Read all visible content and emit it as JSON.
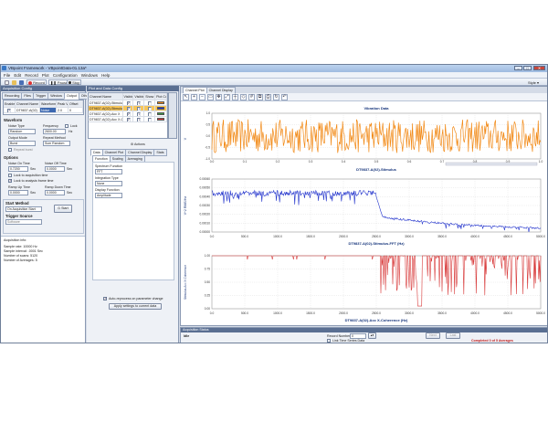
{
  "window": {
    "title": "VBpoint Framework - VBpointData-01.13a*",
    "min": "–",
    "max": "□",
    "close": "✕"
  },
  "menu": [
    "File",
    "Edit",
    "Record",
    "Plot",
    "Configuration",
    "Windows",
    "Help"
  ],
  "toolbar": {
    "record": "Record",
    "pause": "Pause",
    "stop": "Stop",
    "right": "Style ▾"
  },
  "acq": {
    "header": "Acquisition Config",
    "tabs": [
      "Recording",
      "Files",
      "Trigger",
      "Window",
      "Output",
      "Others"
    ],
    "channel_headers": [
      "Enabled",
      "Channel Name",
      "Waveform",
      "Peak Voltage",
      "Offset"
    ],
    "channel_row": {
      "name": "DT9837-A(02)",
      "waveform": "Noise",
      "peak": "2.0",
      "offset": "0"
    },
    "waveform_heading": "Waveform",
    "noise_type_label": "Noise Type",
    "noise_type": "Random",
    "frequency_label": "Frequency",
    "frequency": "2600.00",
    "freq_unit": "Hz",
    "lock_label": "Lock",
    "output_mode_label": "Output Mode",
    "output_mode": "Burst",
    "repeat_label": "Repeat Method",
    "repeat": "Sum Random",
    "repeat_burst": "Repeat burst",
    "options_heading": "Options",
    "noise_on_label": "Noise On Time",
    "noise_on": "0.7200",
    "noise_on_unit": "Sec",
    "noise_off_label": "Noise Off Time",
    "noise_off": "0.0000",
    "noise_off_unit": "Sec",
    "lock_acq": "Lock to acquisition time",
    "lock_frame": "Lock to analysis frame time",
    "ramp_up_label": "Ramp Up Time",
    "ramp_up": "0.0000",
    "ramp_up_unit": "Sec",
    "ramp_down_label": "Ramp Down Time",
    "ramp_down": "0.0000",
    "ramp_down_unit": "Sec",
    "start_heading": "Start Method",
    "start_method": "On Acquisition Start",
    "start_btn": "Start",
    "trigger_label": "Trigger Source",
    "trigger": "Software",
    "info_heading": "Acquisition info:",
    "info": [
      "Sample rate: 10000 Hz",
      "Sample interval: .0001 Sec",
      "Number of scans: 5120",
      "Number of Averages: 5"
    ]
  },
  "plot": {
    "header": "Plot and Data Config",
    "columns": [
      "Channel Name",
      "Visible Plot",
      "Visible Display",
      "Show Cursor",
      "Plot Colour"
    ],
    "rows": [
      {
        "name": "DT9837-A(02)-Stimulus",
        "sel": false,
        "color": "#f28a17"
      },
      {
        "name": "DT9837-A(02)-Stimulus-FFT",
        "sel": true,
        "color": "#2233cc"
      },
      {
        "name": "DT9837-A(02)-Acc X",
        "sel": false,
        "color": "#3c9a4a"
      },
      {
        "name": "DT9837-A(02)-Acc X-Cohere",
        "sel": false,
        "color": "#d83a3a"
      }
    ],
    "actions": "Actions",
    "tabs1": [
      "Data",
      "Channel Plot",
      "Channel Display",
      "Stats"
    ],
    "tabs2": [
      "Function",
      "Scaling",
      "Averaging"
    ],
    "spectrum_label": "Spectrum Function",
    "spectrum": "FFT",
    "integration_label": "Integration Type",
    "integration": "None",
    "display_label": "Display Function",
    "display": "Amplitude",
    "auto_recalc": "Auto-reprocess on parameter change",
    "apply_btn": "Apply settings to current data"
  },
  "main": {
    "tabs": [
      "Channel Plot",
      "Channel Display"
    ],
    "ylabel1": "V",
    "ylabel2": "V^2 RMS/Hz",
    "ylabel3": "Stimulus-Acc X Coherence",
    "title1": "Vibration Data",
    "title2": "DT9837-A(02)-Stimulus",
    "title3": "DT9837-A(02)-Stimulus-FFT (Hz)",
    "title4": "DT9837-A(02)-Acc X-Coherence (Hz)",
    "ticks1": [
      "0.0",
      "0.1",
      "0.2",
      "0.3",
      "0.4",
      "0.5",
      "0.6",
      "0.7",
      "0.8",
      "0.9",
      "1.0"
    ],
    "ticks2": [
      "0.0",
      "500.0",
      "1000.0",
      "1500.0",
      "2000.0",
      "2500.0",
      "3000.0",
      "3500.0",
      "4000.0",
      "4500.0",
      "5000.0"
    ],
    "yticks1": [
      "1.0",
      "0.5",
      "0.0",
      "-0.5",
      "-1.0"
    ],
    "yticks2": [
      "0.00060",
      "0.00050",
      "0.00040",
      "0.00030",
      "0.00020",
      "0.00010",
      "0.00000"
    ],
    "yticks3": [
      "1.00",
      "0.75",
      "0.50",
      "0.25",
      "0.00"
    ]
  },
  "status": {
    "header": "Acquisition Status",
    "state": "Idle",
    "record_label": "Record Number",
    "record": "0",
    "btn1": "Next",
    "btn2": "Last",
    "link_label": "Link Time Series Data",
    "complete": "Completed 0 of 5 Averages"
  },
  "chart_data": [
    {
      "type": "line",
      "title": "Vibration Data",
      "xlabel": "DT9837-A(02)-Stimulus",
      "ylabel": "V",
      "xlim": [
        0,
        1.0
      ],
      "ylim": [
        -1.0,
        1.0
      ],
      "series": [
        {
          "values_desc": "random noise between -0.8 and 0.8"
        }
      ],
      "color": "#f28a17"
    },
    {
      "type": "line",
      "title": "",
      "xlabel": "DT9837-A(02)-Stimulus-FFT (Hz)",
      "ylabel": "V^2 RMS/Hz",
      "xlim": [
        0,
        5000
      ],
      "ylim": [
        0,
        0.0006
      ],
      "color": "#2233cc"
    },
    {
      "type": "line",
      "title": "",
      "xlabel": "DT9837-A(02)-Acc X-Coherence (Hz)",
      "ylabel": "Stimulus-Acc X Coherence",
      "xlim": [
        0,
        5000
      ],
      "ylim": [
        0,
        1.0
      ],
      "color": "#d83a3a"
    }
  ]
}
